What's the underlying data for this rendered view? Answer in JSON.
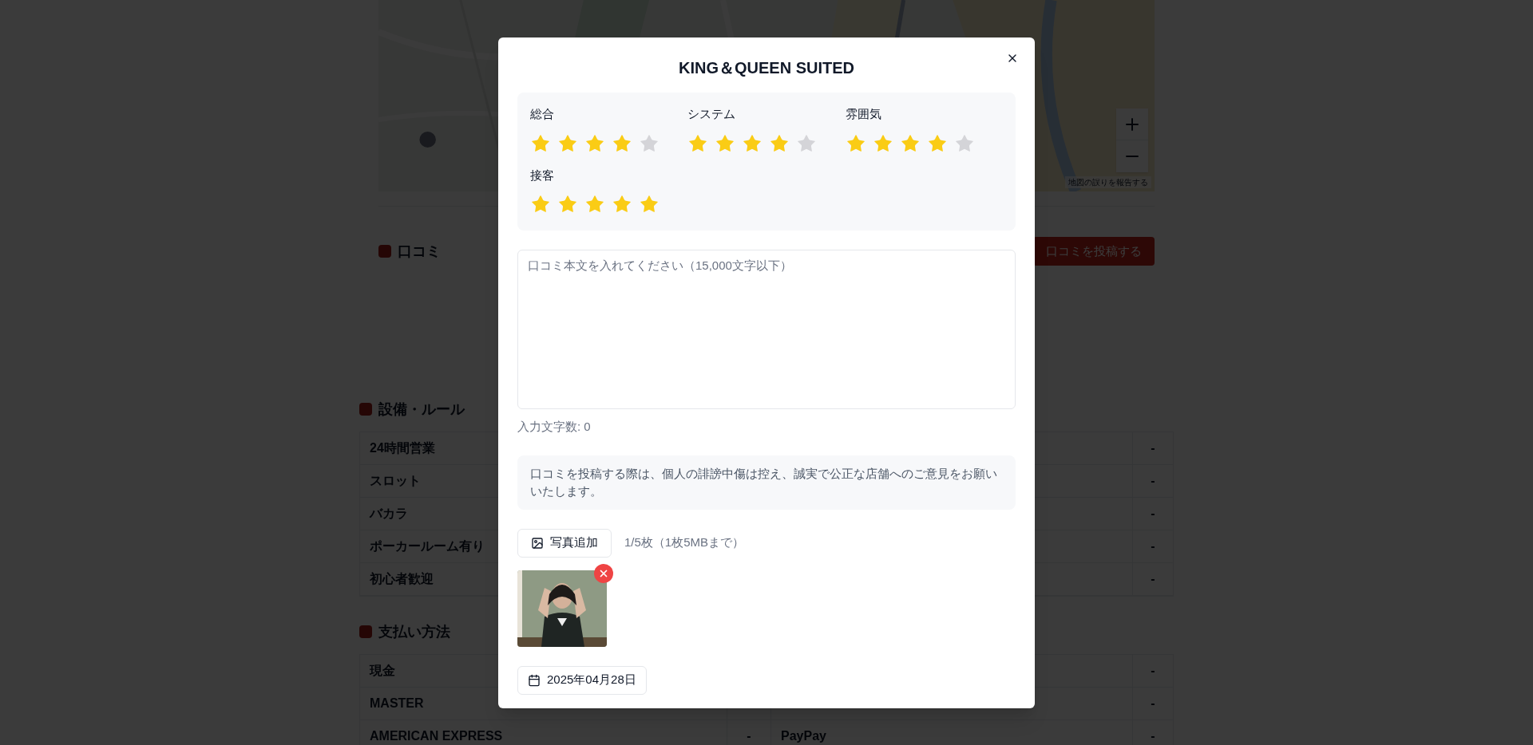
{
  "page": {
    "map": {
      "report_link": "地図の誤りを報告する"
    },
    "reviews": {
      "title": "口コミ",
      "post_button": "口コミを投稿する"
    },
    "sections": [
      {
        "title": "設備・ルール",
        "rows": [
          {
            "column_1": "24時間営業",
            "column_4": "-"
          },
          {
            "column_1": "スロット",
            "column_4": "-"
          },
          {
            "column_1": "バカラ",
            "column_4": "-"
          },
          {
            "column_1": "ポーカールーム有り",
            "column_4": "-"
          },
          {
            "column_1": "初心者歓迎",
            "column_4": "-"
          }
        ]
      },
      {
        "title": "支払い方法",
        "rows": [
          {
            "column_1": "現金",
            "column_4": "-"
          },
          {
            "column_1": "MASTER",
            "column_4": "-"
          },
          {
            "column_1": "AMERICAN EXPRESS",
            "column_2": "-",
            "column_3": "PayPay",
            "column_4": "-"
          }
        ]
      }
    ]
  },
  "modal": {
    "title": "KING＆QUEEN SUITED",
    "ratings": [
      {
        "label": "総合",
        "stars": 4
      },
      {
        "label": "システム",
        "stars": 4
      },
      {
        "label": "雰囲気",
        "stars": 4
      },
      {
        "label": "接客",
        "stars": 5
      }
    ],
    "review_field": {
      "placeholder": "口コミ本文を入れてください（15,000文字以下）"
    },
    "char_count": "入力文字数: 0",
    "notice": "口コミを投稿する際は、個人の誹謗中傷は控え、誠実で公正な店舗へのご意見をお願いいたします。",
    "add_photo_button": "写真追加",
    "photo_limit": "1/5枚（1枚5MBまで）",
    "date_button": "2025年04月28日"
  }
}
